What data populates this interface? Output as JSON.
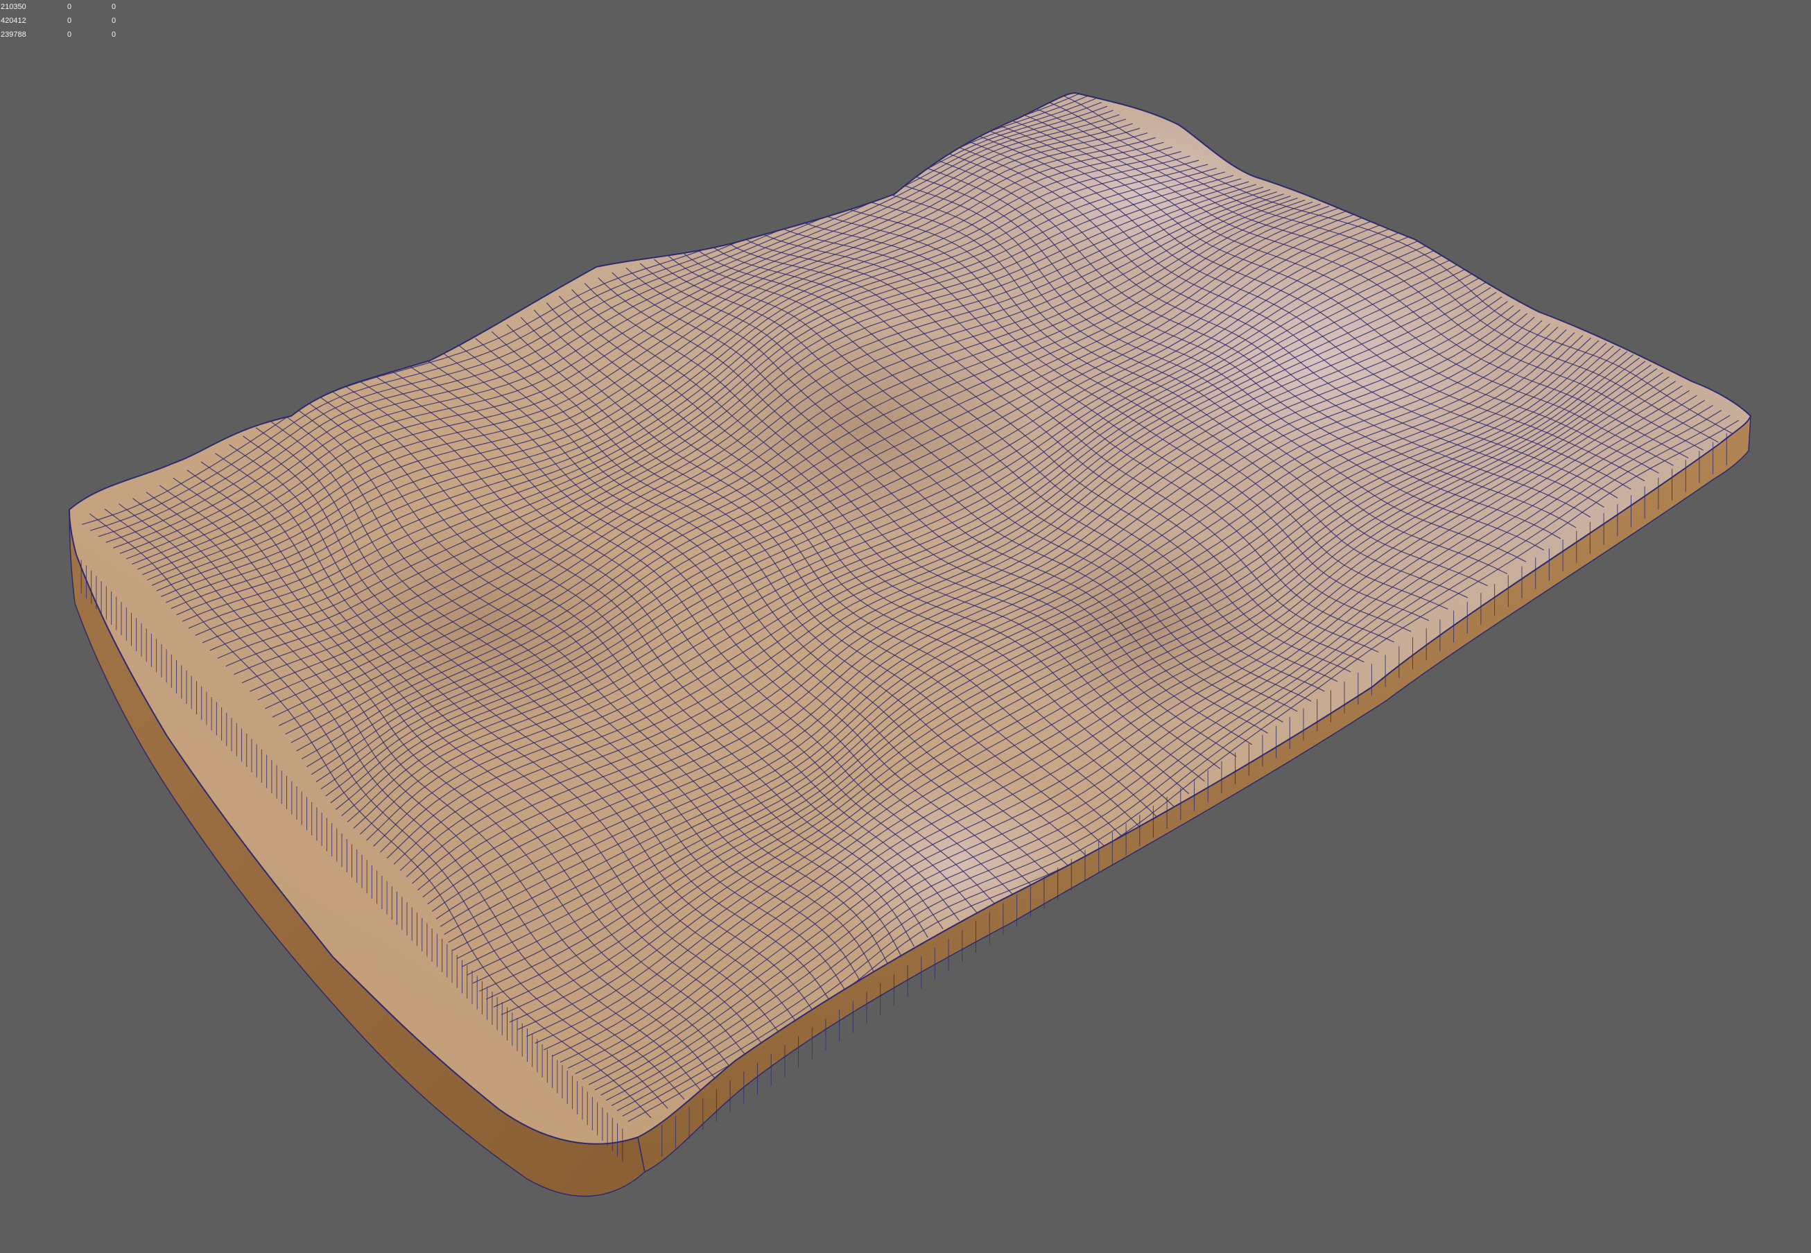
{
  "viewport": {
    "background": "#5e5e5e",
    "object": "terrain-mesh",
    "surface_color": "#c4a07c",
    "side_color": "#a97b4d",
    "wire_color": "#2e2a6e",
    "icon": "terrain-slab-icon"
  },
  "stats": [
    {
      "a": "210350",
      "b": "0",
      "c": "0"
    },
    {
      "a": "420412",
      "b": "0",
      "c": "0"
    },
    {
      "a": "239788",
      "b": "0",
      "c": "0"
    }
  ]
}
